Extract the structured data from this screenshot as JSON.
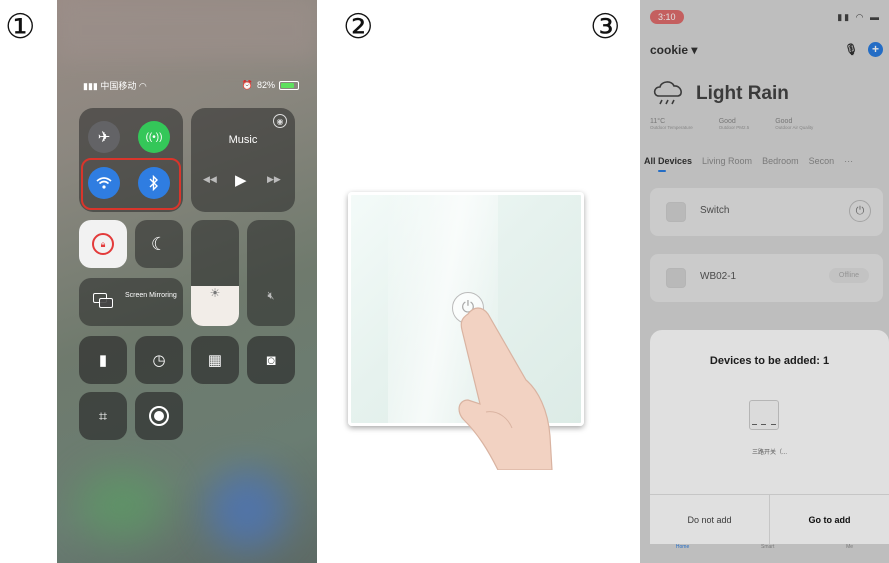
{
  "steps": [
    "①",
    "②",
    "③"
  ],
  "control_center": {
    "status": {
      "carrier": "中国移动",
      "battery": "82%"
    },
    "music_label": "Music",
    "screen_mirroring_label": "Screen Mirroring"
  },
  "app": {
    "status_time": "3:10",
    "home_name": "cookie",
    "weather": {
      "condition": "Light Rain",
      "stats": [
        {
          "value": "11°C",
          "label": "Outdoor Temperature"
        },
        {
          "value": "Good",
          "label": "Outdoor PM2.5"
        },
        {
          "value": "Good",
          "label": "Outdoor Air Quality"
        }
      ]
    },
    "tabs": [
      "All Devices",
      "Living Room",
      "Bedroom",
      "Secon",
      "···"
    ],
    "devices": [
      {
        "name": "Switch"
      },
      {
        "name": "WB02-1",
        "status": "Offline"
      }
    ],
    "add_sheet": {
      "title": "Devices to be added: 1",
      "device_name": "三路开关（...",
      "cancel_label": "Do not add",
      "confirm_label": "Go to add"
    },
    "nav": [
      "Home",
      "Smart",
      "Me"
    ]
  },
  "colors": {
    "accent": "#2a7de1",
    "highlight": "#d9352b",
    "airplane": "#636366",
    "cellular": "#34c759",
    "wifi_bt": "#2f7de1"
  }
}
